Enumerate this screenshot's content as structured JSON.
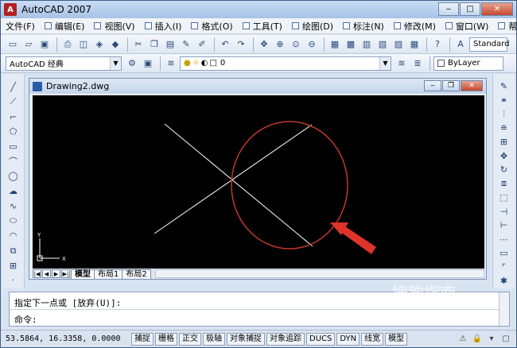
{
  "window": {
    "title": "AutoCAD 2007",
    "app_icon_letter": "A"
  },
  "menubar": {
    "items": [
      "文件(F)",
      "编辑(E)",
      "视图(V)",
      "插入(I)",
      "格式(O)",
      "工具(T)",
      "绘图(D)",
      "标注(N)",
      "修改(M)",
      "窗口(W)",
      "帮助(H)"
    ]
  },
  "toolbar1": {
    "text_style": "Standard"
  },
  "toolbar2": {
    "workspace": "AutoCAD 经典",
    "layer_value": "0",
    "color_value": "ByLayer"
  },
  "drawing": {
    "title": "Drawing2.dwg",
    "ucs_x_label": "X",
    "ucs_y_label": "Y",
    "tabs": [
      "模型",
      "布局1",
      "布局2"
    ],
    "active_tab": "模型"
  },
  "command": {
    "line1": "指定下一点或 [放弃(U)]:",
    "line2": "命令:"
  },
  "status": {
    "coords": "53.5864, 16.3358, 0.0000",
    "toggles": [
      "捕捉",
      "栅格",
      "正交",
      "极轴",
      "对象捕捉",
      "对象追踪",
      "DUCS",
      "DYN",
      "线宽",
      "模型"
    ]
  },
  "watermark": {
    "text": "搜狗指南"
  },
  "colors": {
    "canvas_bg": "#000000",
    "line": "#ffffff",
    "circle": "#c0392b",
    "arrow": "#e0332a"
  },
  "icons": {
    "left": [
      "line-icon",
      "ray-icon",
      "polyline-icon",
      "polygon-icon",
      "rectangle-icon",
      "arc-icon",
      "circle-icon",
      "cloud-icon",
      "spline-icon",
      "ellipse-icon",
      "ellipse-arc-icon",
      "insert-block-icon",
      "make-block-icon",
      "point-icon"
    ],
    "right": [
      "erase-icon",
      "copy-icon",
      "mirror-icon",
      "offset-icon",
      "array-icon",
      "move-icon",
      "rotate-icon",
      "scale-icon",
      "stretch-icon",
      "trim-icon",
      "extend-icon",
      "break-icon",
      "join-icon",
      "chamfer-icon",
      "explode-icon"
    ]
  }
}
